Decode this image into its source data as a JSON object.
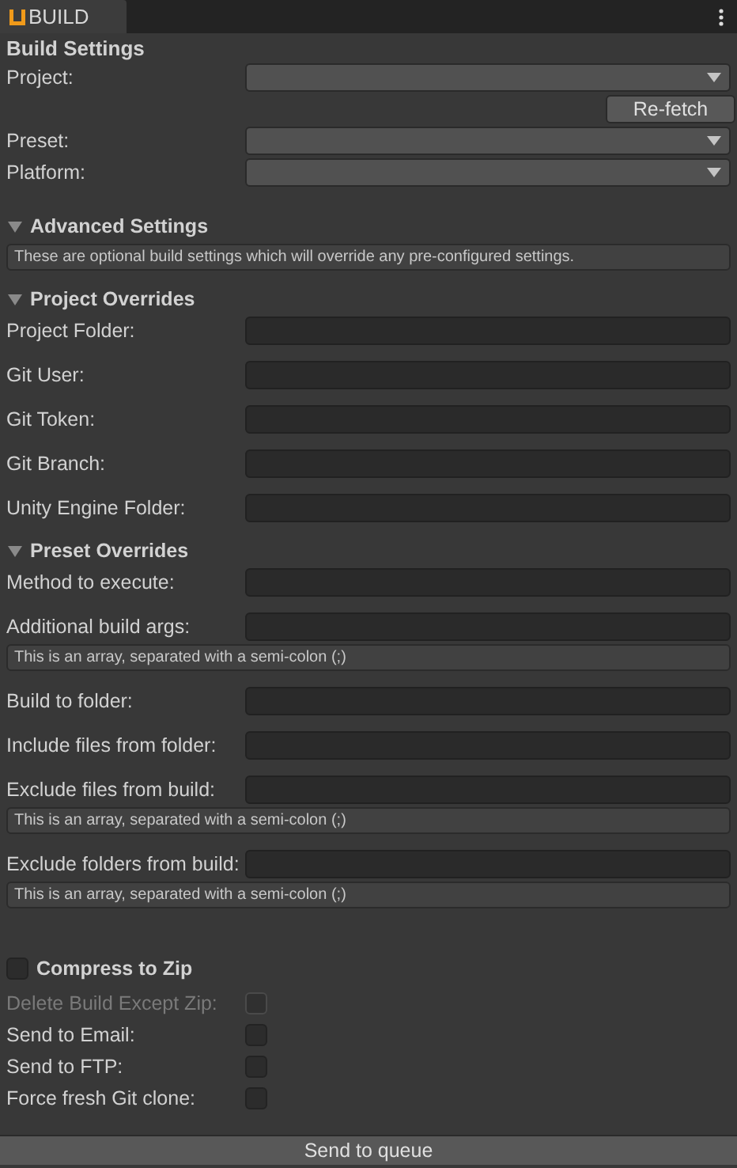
{
  "tab": {
    "title": "BUILD",
    "selected": true
  },
  "build_settings": {
    "title": "Build Settings",
    "items": [
      {
        "kind": "dropdown",
        "label": "Project:"
      },
      {
        "kind": "button",
        "label": "Re-fetch"
      },
      {
        "kind": "dropdown",
        "label": "Preset:"
      },
      {
        "kind": "dropdown",
        "label": "Platform:"
      }
    ]
  },
  "sections": [
    {
      "title": "Advanced Settings",
      "expanded": true,
      "items": [
        {
          "kind": "help",
          "text": "These are optional build settings which will override any pre-configured settings."
        }
      ]
    },
    {
      "title": "Project Overrides",
      "expanded": true,
      "items": [
        {
          "kind": "text",
          "label": "Project Folder:"
        },
        {
          "kind": "text",
          "label": "Git User:"
        },
        {
          "kind": "text",
          "label": "Git Token:"
        },
        {
          "kind": "text",
          "label": "Git Branch:"
        },
        {
          "kind": "text",
          "label": "Unity Engine Folder:"
        }
      ]
    },
    {
      "title": "Preset Overrides",
      "expanded": true,
      "items": [
        {
          "kind": "text",
          "label": "Method to execute:"
        },
        {
          "kind": "text",
          "label": "Additional build args:"
        },
        {
          "kind": "help",
          "text": "This is an array, separated with a semi-colon (;)"
        },
        {
          "kind": "text",
          "label": "Build to folder:"
        },
        {
          "kind": "text",
          "label": "Include files from folder:"
        },
        {
          "kind": "text",
          "label": "Exclude files from build:"
        },
        {
          "kind": "help",
          "text": "This is an array, separated with a semi-colon (;)"
        },
        {
          "kind": "text",
          "label": "Exclude folders from build:"
        },
        {
          "kind": "help",
          "text": "This is an array, separated with a semi-colon (;)"
        }
      ]
    }
  ],
  "compress": {
    "label": "Compress to Zip",
    "checked": false
  },
  "options": [
    {
      "label": "Delete Build Except Zip:",
      "checked": false,
      "disabled": true
    },
    {
      "label": "Send to Email:",
      "checked": false,
      "disabled": false
    },
    {
      "label": "Send to FTP:",
      "checked": false,
      "disabled": false
    },
    {
      "label": "Force fresh Git clone:",
      "checked": false,
      "disabled": false
    }
  ],
  "submit": "Send to queue"
}
